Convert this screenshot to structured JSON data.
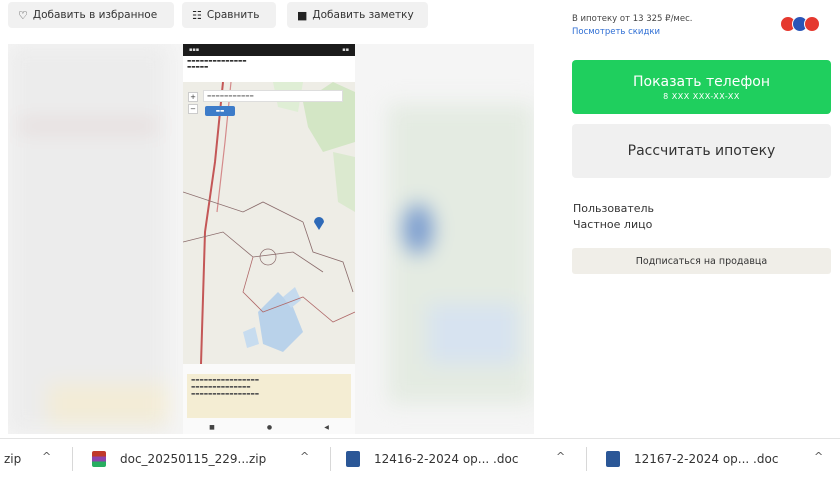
{
  "actions": {
    "favorite_label": "Добавить в избранное",
    "compare_label": "Сравнить",
    "note_label": "Добавить заметку"
  },
  "mortgage": {
    "text": "В ипотеку от 13 325 ₽/мес.",
    "discounts_link": "Посмотреть скидки"
  },
  "contact": {
    "show_phone_label": "Показать телефон",
    "masked_phone": "8 XXX XXX-XX-XX",
    "calc_mortgage_label": "Рассчитать ипотеку"
  },
  "seller": {
    "type": "Пользователь",
    "name": "Частное лицо",
    "subscribe_label": "Подписаться на продавца"
  },
  "downloads": [
    {
      "name": "zip"
    },
    {
      "name": "doc_20250115_229...zip"
    },
    {
      "name": "12416-2-2024 ор... .doc"
    },
    {
      "name": "12167-2-2024 ор... .doc"
    }
  ],
  "colors": {
    "primary_green": "#1fcf5e",
    "link_blue": "#2e6ed4",
    "button_gray": "#f0f0f0"
  }
}
